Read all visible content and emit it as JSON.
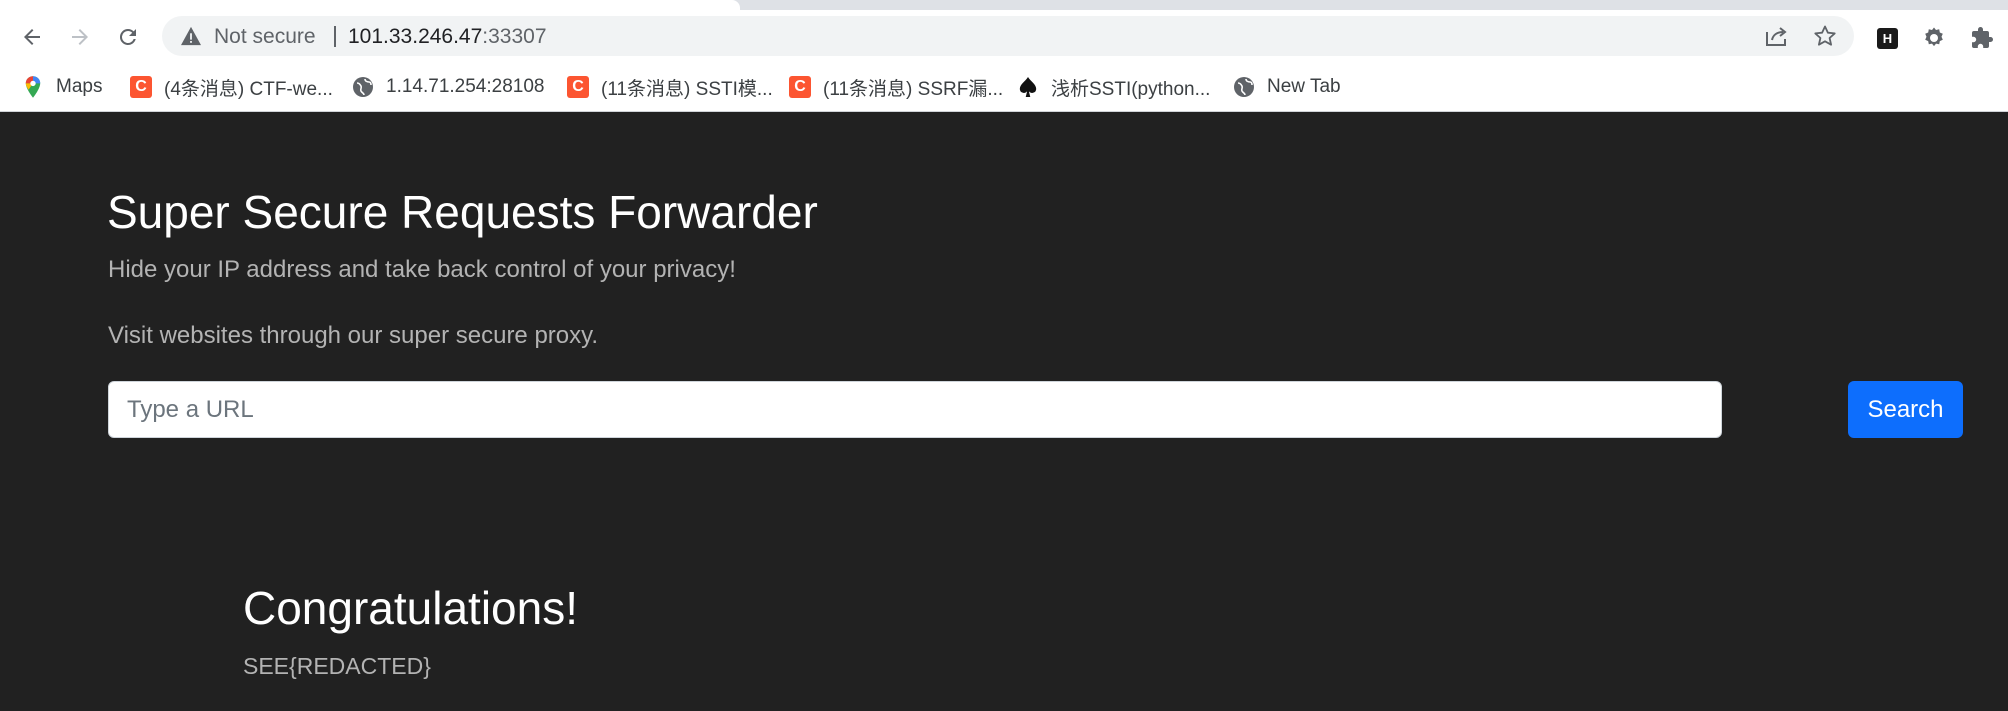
{
  "browser": {
    "security_label": "Not secure",
    "url_host": "101.33.246.47",
    "url_port": ":33307"
  },
  "bookmarks": [
    {
      "label": "Maps",
      "icon": "maps-pin-icon"
    },
    {
      "label": "(4条消息) CTF-we...",
      "icon": "csdn-icon"
    },
    {
      "label": "1.14.71.254:28108",
      "icon": "globe-icon"
    },
    {
      "label": "(11条消息) SSTI模...",
      "icon": "csdn-icon"
    },
    {
      "label": "(11条消息) SSRF漏...",
      "icon": "csdn-icon"
    },
    {
      "label": "浅析SSTI(python...",
      "icon": "spade-icon"
    },
    {
      "label": "New Tab",
      "icon": "globe-icon"
    }
  ],
  "extensions": {
    "h_label": "H"
  },
  "page": {
    "title": "Super Secure Requests Forwarder",
    "subtitle": "Hide your IP address and take back control of your privacy!",
    "description": "Visit websites through our super secure proxy.",
    "url_placeholder": "Type a URL",
    "search_label": "Search",
    "result_title": "Congratulations!",
    "result_text": "SEE{REDACTED}"
  },
  "colors": {
    "page_background": "#212121",
    "search_button": "#0d6efd",
    "csdn_brand": "#fc5531"
  }
}
